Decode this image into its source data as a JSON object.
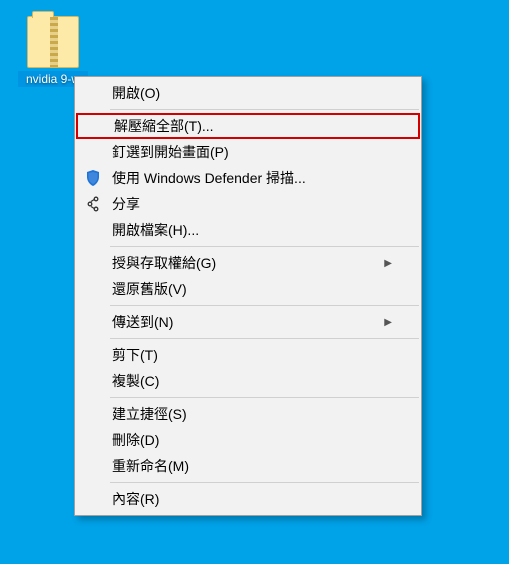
{
  "desktop": {
    "file_label": "nvidia\n9-w"
  },
  "menu": {
    "open": "開啟(O)",
    "extract_all": "解壓縮全部(T)...",
    "pin_to_start": "釘選到開始畫面(P)",
    "defender_scan": "使用 Windows Defender 掃描...",
    "share": "分享",
    "open_with": "開啟檔案(H)...",
    "give_access": "授與存取權給(G)",
    "restore_previous": "還原舊版(V)",
    "send_to": "傳送到(N)",
    "cut": "剪下(T)",
    "copy": "複製(C)",
    "create_shortcut": "建立捷徑(S)",
    "delete": "刪除(D)",
    "rename": "重新命名(M)",
    "properties": "內容(R)"
  }
}
